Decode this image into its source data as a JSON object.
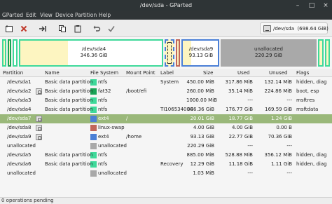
{
  "window": {
    "title": "/dev/sda - GParted"
  },
  "menu": [
    "GParted",
    "Edit",
    "View",
    "Device",
    "Partition",
    "Help"
  ],
  "device": {
    "label": "/dev/sda",
    "size": "(698.64 GiB)"
  },
  "map": {
    "sda4": {
      "name": "/dev/sda4",
      "size": "346.36 GiB"
    },
    "sda9": {
      "name": "/dev/sda9",
      "size": "93.13 GiB"
    },
    "unalloc": {
      "name": "unallocated",
      "size": "220.29 GiB"
    }
  },
  "table": {
    "headers": [
      "Partition",
      "Name",
      "File System",
      "Mount Point",
      "Label",
      "Size",
      "Used",
      "Unused",
      "Flags"
    ],
    "rows": [
      {
        "partition": "/dev/sda1",
        "name": "Basic data partition",
        "fs": "ntfs",
        "fs_color": "#3ed99a",
        "mount": "",
        "label": "System",
        "size": "450.00 MiB",
        "used": "317.86 MiB",
        "unused": "132.14 MiB",
        "flags": "hidden, diag",
        "locked": false,
        "selected": false
      },
      {
        "partition": "/dev/sda2",
        "name": "Basic data partition",
        "fs": "fat32",
        "fs_color": "#19a356",
        "mount": "/boot/efi",
        "label": "",
        "size": "260.00 MiB",
        "used": "35.14 MiB",
        "unused": "224.86 MiB",
        "flags": "boot, esp",
        "locked": true,
        "selected": false
      },
      {
        "partition": "/dev/sda3",
        "name": "Basic data partition",
        "fs": "ntfs",
        "fs_color": "#3ed99a",
        "mount": "",
        "label": "",
        "size": "1000.00 MiB",
        "used": "---",
        "unused": "---",
        "flags": "msftres",
        "locked": false,
        "selected": false
      },
      {
        "partition": "/dev/sda4",
        "name": "Basic data partition",
        "fs": "ntfs",
        "fs_color": "#3ed99a",
        "mount": "",
        "label": "TI10653400C",
        "size": "346.36 GiB",
        "used": "176.77 GiB",
        "unused": "169.59 GiB",
        "flags": "msftdata",
        "locked": false,
        "selected": false
      },
      {
        "partition": "/dev/sda7",
        "name": "",
        "fs": "ext4",
        "fs_color": "#4a7fd6",
        "mount": "/",
        "label": "",
        "size": "20.01 GiB",
        "used": "18.77 GiB",
        "unused": "1.24 GiB",
        "flags": "",
        "locked": true,
        "selected": true
      },
      {
        "partition": "/dev/sda8",
        "name": "",
        "fs": "linux-swap",
        "fs_color": "#c1665a",
        "mount": "",
        "label": "",
        "size": "4.00 GiB",
        "used": "4.00 GiB",
        "unused": "0.00 B",
        "flags": "",
        "locked": true,
        "selected": false
      },
      {
        "partition": "/dev/sda9",
        "name": "",
        "fs": "ext4",
        "fs_color": "#4a7fd6",
        "mount": "/home",
        "label": "",
        "size": "93.13 GiB",
        "used": "22.77 GiB",
        "unused": "70.36 GiB",
        "flags": "",
        "locked": true,
        "selected": false
      },
      {
        "partition": "unallocated",
        "name": "",
        "fs": "unallocated",
        "fs_color": "#a9a9a9",
        "mount": "",
        "label": "",
        "size": "220.29 GiB",
        "used": "---",
        "unused": "---",
        "flags": "",
        "locked": false,
        "selected": false
      },
      {
        "partition": "/dev/sda5",
        "name": "Basic data partition",
        "fs": "ntfs",
        "fs_color": "#3ed99a",
        "mount": "",
        "label": "",
        "size": "885.00 MiB",
        "used": "528.88 MiB",
        "unused": "356.12 MiB",
        "flags": "hidden, diag",
        "locked": false,
        "selected": false
      },
      {
        "partition": "/dev/sda6",
        "name": "Basic data partition",
        "fs": "ntfs",
        "fs_color": "#3ed99a",
        "mount": "",
        "label": "Recovery",
        "size": "12.29 GiB",
        "used": "11.18 GiB",
        "unused": "1.11 GiB",
        "flags": "hidden, diag",
        "locked": false,
        "selected": false
      },
      {
        "partition": "unallocated",
        "name": "",
        "fs": "unallocated",
        "fs_color": "#a9a9a9",
        "mount": "",
        "label": "",
        "size": "1.03 MiB",
        "used": "---",
        "unused": "---",
        "flags": "",
        "locked": false,
        "selected": false
      }
    ]
  },
  "status": "0 operations pending",
  "colors": {
    "ntfs": "#3ed99a",
    "fat32": "#19a356",
    "ext4": "#4a7fd6",
    "swap": "#c1665a",
    "unallocated": "#a9a9a9",
    "selected_row": "#9ab87a",
    "used_fill": "#fdf5c1"
  }
}
